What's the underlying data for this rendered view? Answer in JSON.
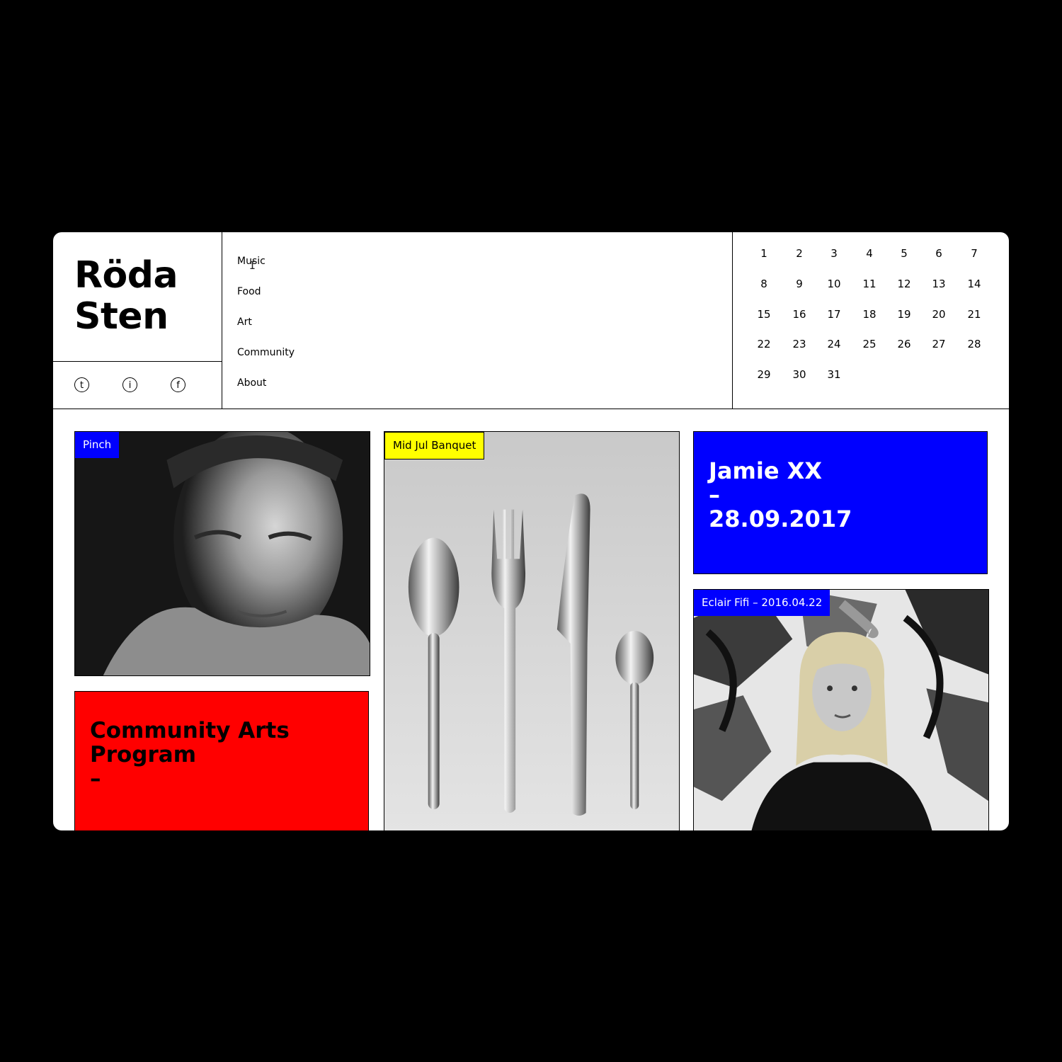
{
  "brand": {
    "line1": "Röda",
    "line2": "Sten"
  },
  "social": [
    {
      "glyph": "t",
      "icon": "twitter-icon"
    },
    {
      "glyph": "i",
      "icon": "instagram-icon"
    },
    {
      "glyph": "f",
      "icon": "facebook-icon"
    }
  ],
  "nav": {
    "items": [
      {
        "label": "Music"
      },
      {
        "label": "Food"
      },
      {
        "label": "Art"
      },
      {
        "label": "Community"
      },
      {
        "label": "About"
      }
    ]
  },
  "calendar": {
    "days": [
      "1",
      "2",
      "3",
      "4",
      "5",
      "6",
      "7",
      "8",
      "9",
      "10",
      "11",
      "12",
      "13",
      "14",
      "15",
      "16",
      "17",
      "18",
      "19",
      "20",
      "21",
      "22",
      "23",
      "24",
      "25",
      "26",
      "27",
      "28",
      "29",
      "30",
      "31"
    ]
  },
  "cards": {
    "pinch": {
      "tag": "Pinch"
    },
    "banquet": {
      "tag": "Mid Jul Banquet"
    },
    "jamie": {
      "line1": "Jamie XX",
      "line2": "–",
      "line3": "28.09.2017"
    },
    "community": {
      "line1": "Community Arts",
      "line2": "Program",
      "line3": "–"
    },
    "eclair": {
      "tag": "Eclair Fifi – 2016.04.22"
    }
  },
  "colors": {
    "blue": "#0000ff",
    "red": "#ff0000",
    "yellow": "#ffff00",
    "frame": "#000000"
  }
}
